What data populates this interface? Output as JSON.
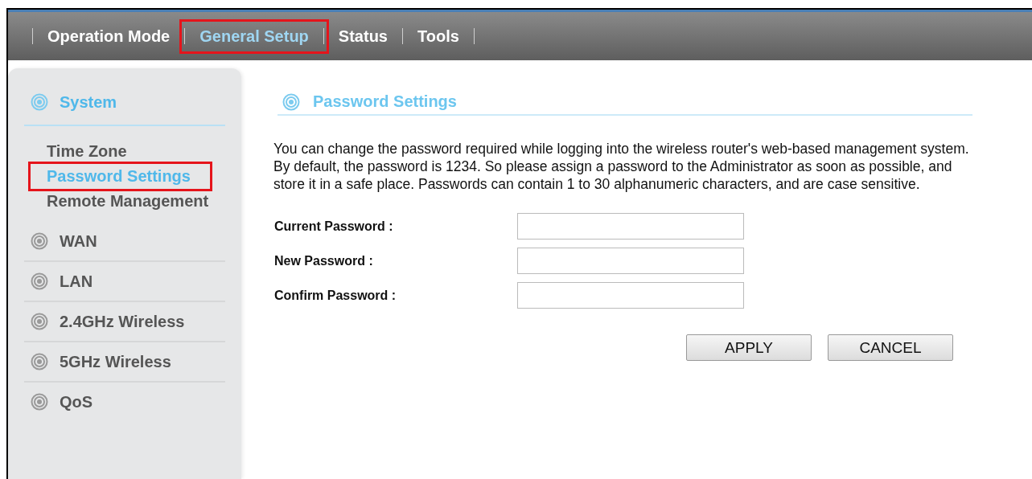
{
  "nav": [
    {
      "label": "Operation Mode",
      "selected": false,
      "highlighted": false
    },
    {
      "label": "General Setup",
      "selected": true,
      "highlighted": true
    },
    {
      "label": "Status",
      "selected": false,
      "highlighted": false
    },
    {
      "label": "Tools",
      "selected": false,
      "highlighted": false
    }
  ],
  "sidebar": {
    "sections": [
      {
        "label": "System",
        "selected": true,
        "children": [
          {
            "label": "Time Zone",
            "selected": false,
            "highlighted": false
          },
          {
            "label": "Password Settings",
            "selected": true,
            "highlighted": true
          },
          {
            "label": "Remote Management",
            "selected": false,
            "highlighted": false
          }
        ]
      },
      {
        "label": "WAN",
        "selected": false
      },
      {
        "label": "LAN",
        "selected": false
      },
      {
        "label": "2.4GHz Wireless",
        "selected": false
      },
      {
        "label": "5GHz Wireless",
        "selected": false
      },
      {
        "label": "QoS",
        "selected": false
      }
    ]
  },
  "content": {
    "title": "Password Settings",
    "description": "You can change the password required while logging into the wireless router's web-based management system. By default, the password is 1234. So please assign a password to the Administrator as soon as possible, and store it in a safe place. Passwords can contain 1 to 30 alphanumeric characters, and are case sensitive.",
    "fields": [
      {
        "label": "Current Password :"
      },
      {
        "label": "New Password :"
      },
      {
        "label": "Confirm Password :"
      }
    ],
    "buttons": [
      "APPLY",
      "CANCEL"
    ]
  }
}
